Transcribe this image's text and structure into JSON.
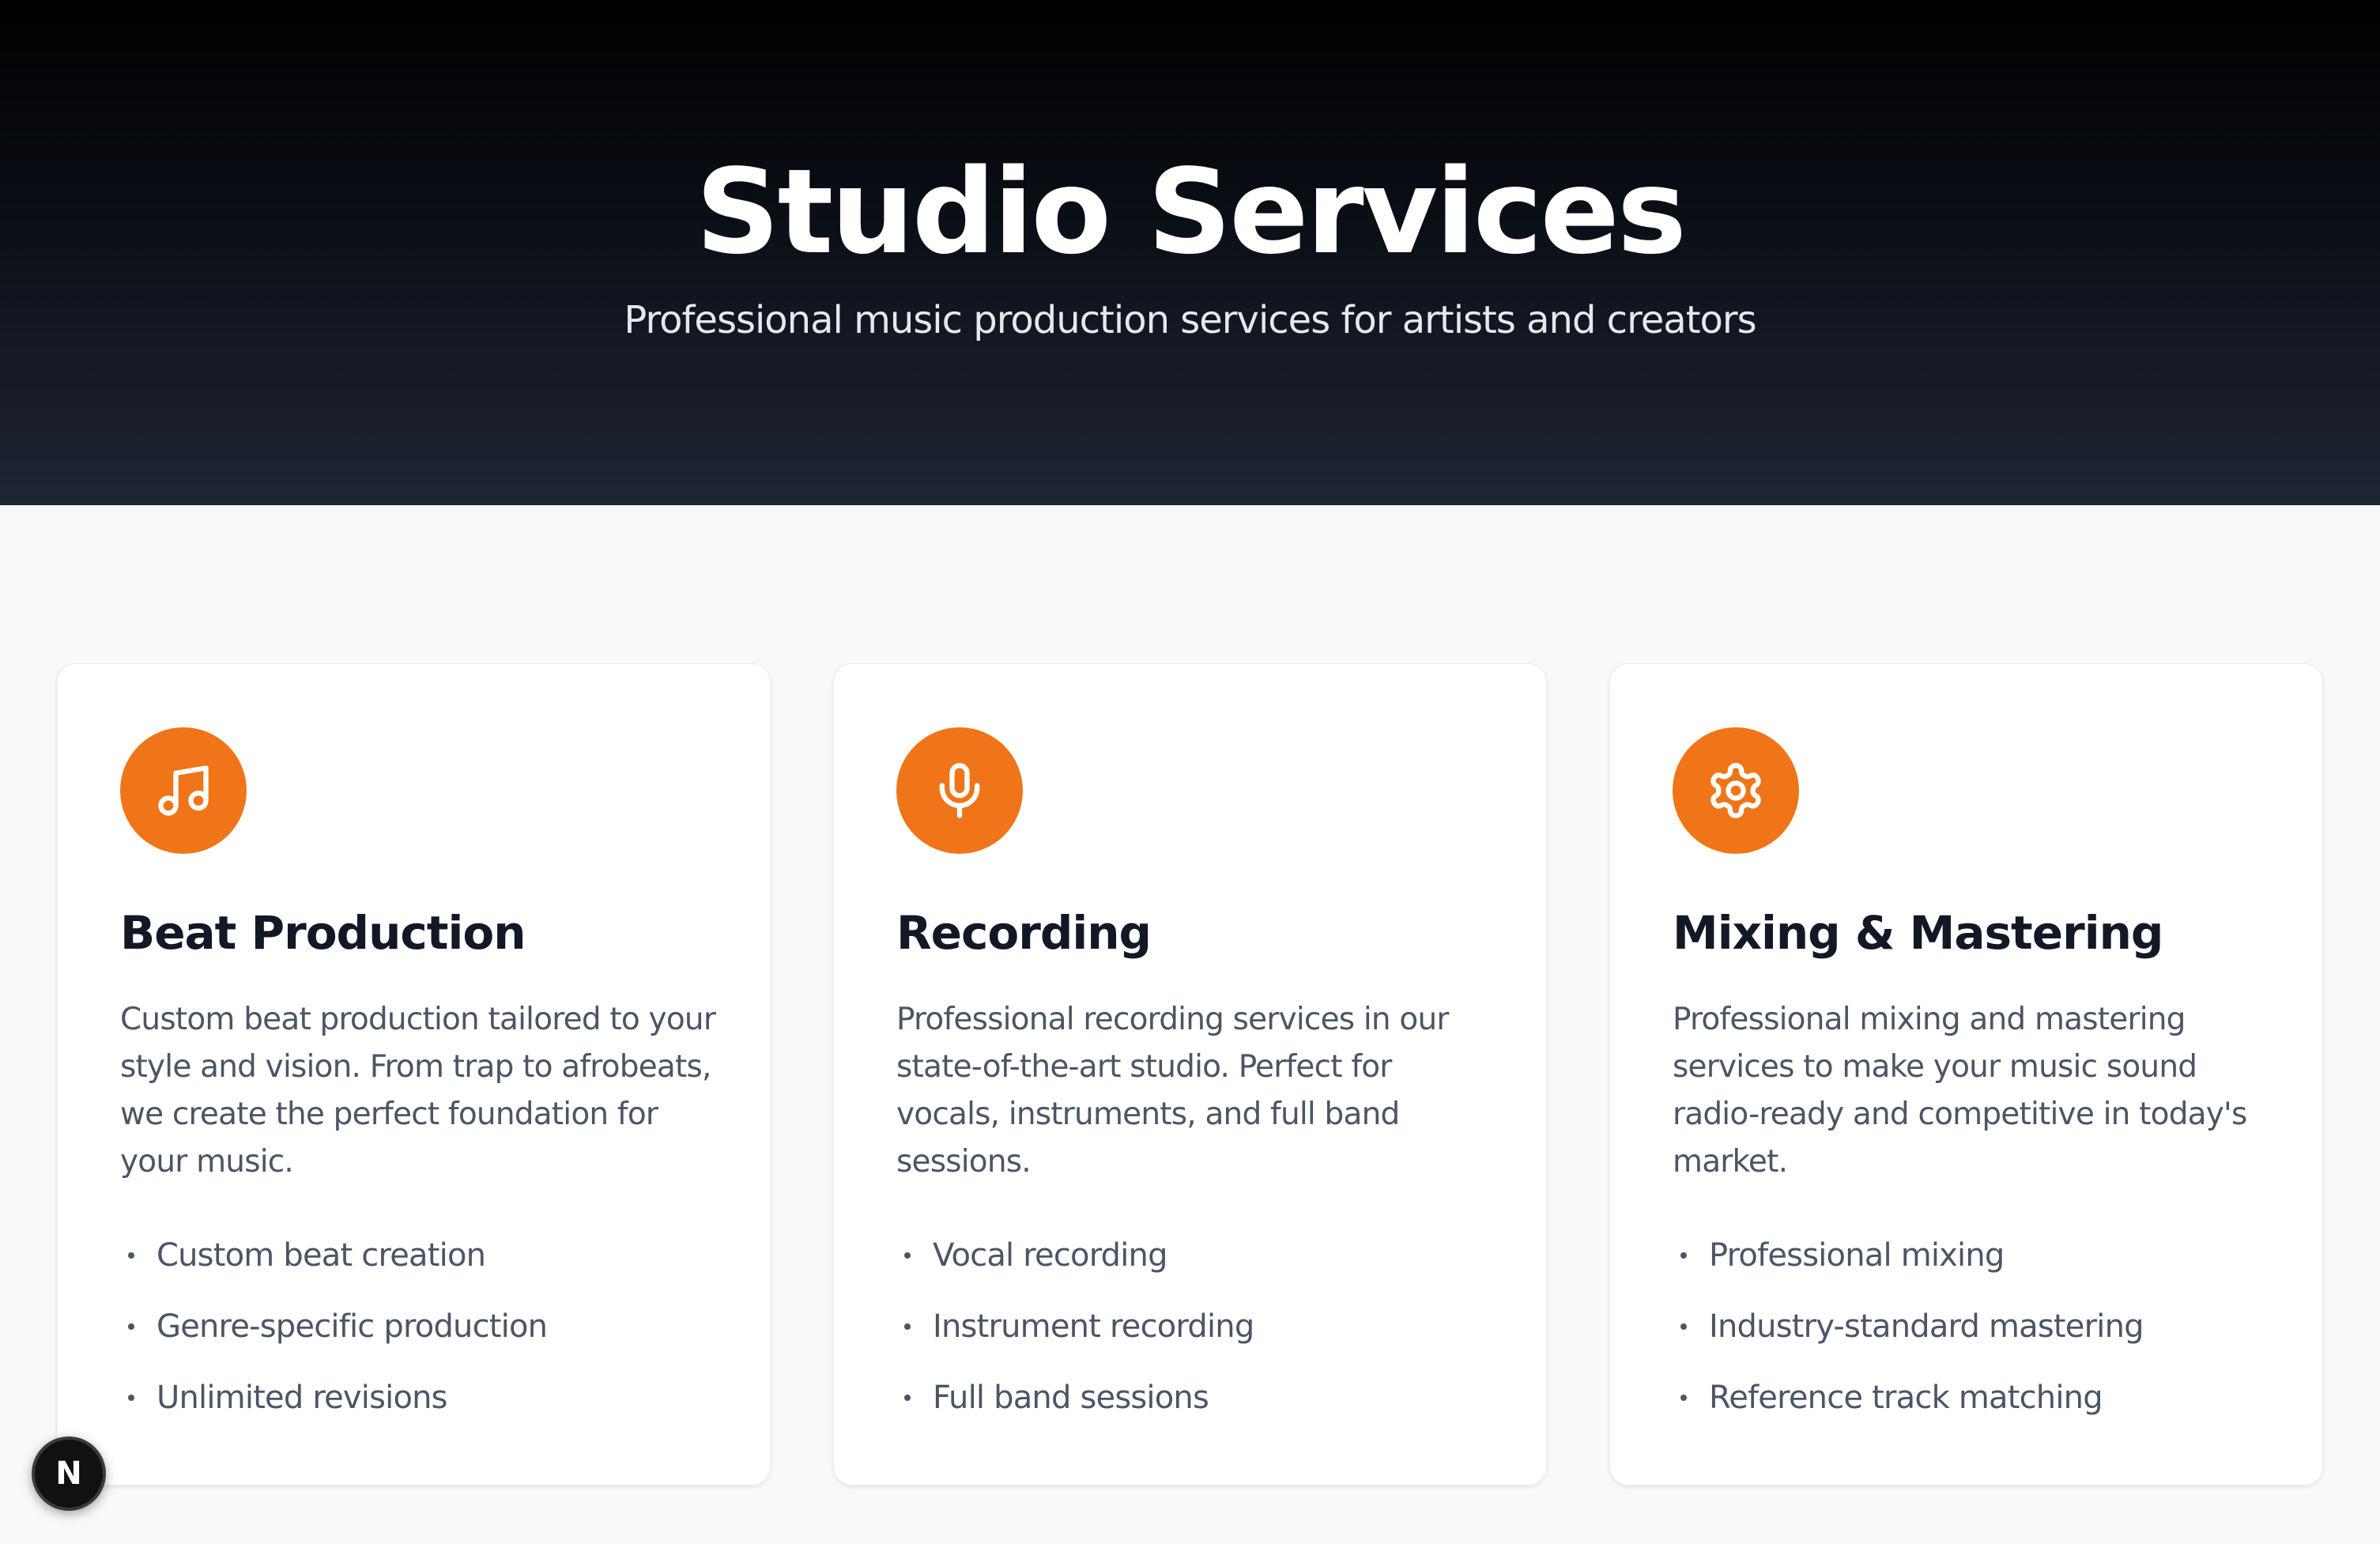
{
  "hero": {
    "title": "Studio Services",
    "subtitle": "Professional music production services for artists and creators"
  },
  "colors": {
    "accent": "#f07518",
    "hero_top": "#000000",
    "hero_bottom": "#1f2533",
    "page_background": "#f8f9fb",
    "card_background": "#ffffff",
    "heading_text": "#121826",
    "body_text": "#4b5565"
  },
  "services": [
    {
      "icon": "music-note-icon",
      "title": "Beat Production",
      "description": "Custom beat production tailored to your style and vision. From trap to afrobeats, we create the perfect foundation for your music.",
      "features": [
        "Custom beat creation",
        "Genre-specific production",
        "Unlimited revisions"
      ]
    },
    {
      "icon": "microphone-icon",
      "title": "Recording",
      "description": "Professional recording services in our state-of-the-art studio. Perfect for vocals, instruments, and full band sessions.",
      "features": [
        "Vocal recording",
        "Instrument recording",
        "Full band sessions"
      ]
    },
    {
      "icon": "gear-icon",
      "title": "Mixing & Mastering",
      "description": "Professional mixing and mastering services to make your music sound radio-ready and competitive in today's market.",
      "features": [
        "Professional mixing",
        "Industry-standard mastering",
        "Reference track matching"
      ]
    }
  ],
  "dev_badge": {
    "icon": "nextjs-icon",
    "label": "N"
  }
}
